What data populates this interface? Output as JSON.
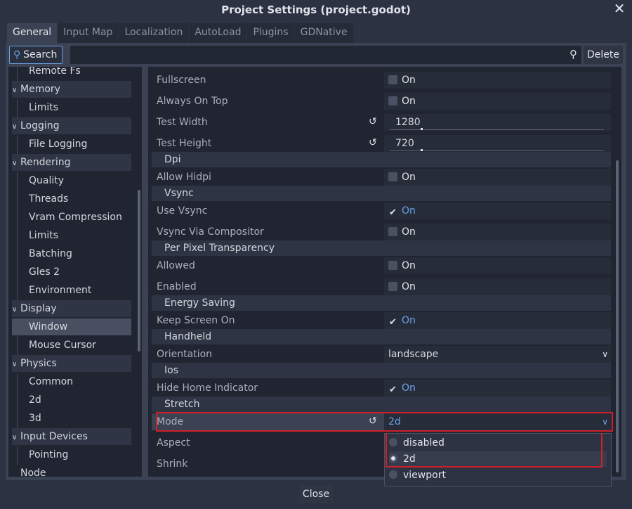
{
  "window": {
    "title": "Project Settings (project.godot)",
    "close_glyph": "✕"
  },
  "tabs": [
    "General",
    "Input Map",
    "Localization",
    "AutoLoad",
    "Plugins",
    "GDNative"
  ],
  "toolbar": {
    "search_label": "Search",
    "delete_label": "Delete",
    "filter_value": ""
  },
  "tree": [
    {
      "label": "Remote Fs",
      "kind": "child"
    },
    {
      "label": "Memory",
      "kind": "cat"
    },
    {
      "label": "Limits",
      "kind": "child"
    },
    {
      "label": "Logging",
      "kind": "cat"
    },
    {
      "label": "File Logging",
      "kind": "child"
    },
    {
      "label": "Rendering",
      "kind": "cat"
    },
    {
      "label": "Quality",
      "kind": "child"
    },
    {
      "label": "Threads",
      "kind": "child"
    },
    {
      "label": "Vram Compression",
      "kind": "child"
    },
    {
      "label": "Limits",
      "kind": "child"
    },
    {
      "label": "Batching",
      "kind": "child"
    },
    {
      "label": "Gles 2",
      "kind": "child"
    },
    {
      "label": "Environment",
      "kind": "child"
    },
    {
      "label": "Display",
      "kind": "cat"
    },
    {
      "label": "Window",
      "kind": "child",
      "selected": true
    },
    {
      "label": "Mouse Cursor",
      "kind": "child"
    },
    {
      "label": "Physics",
      "kind": "cat"
    },
    {
      "label": "Common",
      "kind": "child"
    },
    {
      "label": "2d",
      "kind": "child"
    },
    {
      "label": "3d",
      "kind": "child"
    },
    {
      "label": "Input Devices",
      "kind": "cat"
    },
    {
      "label": "Pointing",
      "kind": "child"
    },
    {
      "label": "Node",
      "kind": "root"
    }
  ],
  "properties": {
    "fullscreen": {
      "label": "Fullscreen",
      "value": "On"
    },
    "always_on_top": {
      "label": "Always On Top",
      "value": "On"
    },
    "test_width": {
      "label": "Test Width",
      "value": "1280"
    },
    "test_height": {
      "label": "Test Height",
      "value": "720"
    },
    "dpi_section": "Dpi",
    "allow_hidpi": {
      "label": "Allow Hidpi",
      "value": "On"
    },
    "vsync_section": "Vsync",
    "use_vsync": {
      "label": "Use Vsync",
      "value": "On"
    },
    "vsync_via_compositor": {
      "label": "Vsync Via Compositor",
      "value": "On"
    },
    "ppt_section": "Per Pixel Transparency",
    "allowed": {
      "label": "Allowed",
      "value": "On"
    },
    "enabled": {
      "label": "Enabled",
      "value": "On"
    },
    "energy_section": "Energy Saving",
    "keep_screen_on": {
      "label": "Keep Screen On",
      "value": "On"
    },
    "handheld_section": "Handheld",
    "orientation": {
      "label": "Orientation",
      "value": "landscape"
    },
    "ios_section": "Ios",
    "hide_home_indicator": {
      "label": "Hide Home Indicator",
      "value": "On"
    },
    "stretch_section": "Stretch",
    "mode": {
      "label": "Mode",
      "value": "2d"
    },
    "aspect": {
      "label": "Aspect"
    },
    "shrink": {
      "label": "Shrink"
    }
  },
  "mode_popup": [
    "disabled",
    "2d",
    "viewport"
  ],
  "footer": {
    "close_label": "Close"
  },
  "colors": {
    "accent": "#6aa0e6",
    "highlight_outline": "#d0202a"
  }
}
